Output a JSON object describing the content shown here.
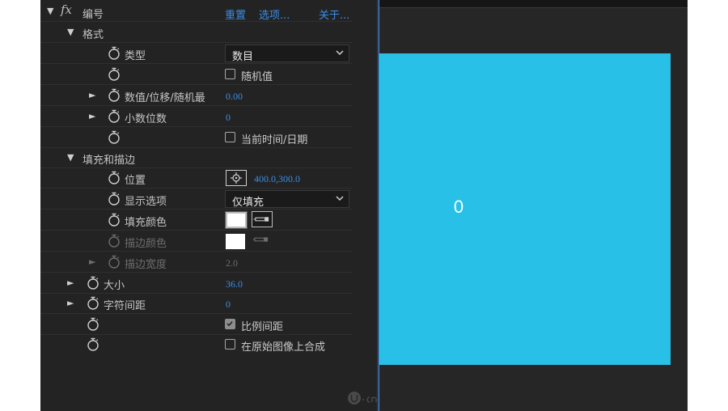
{
  "effect": {
    "name": "编号",
    "reset": "重置",
    "options": "选项...",
    "about": "关于..."
  },
  "format": {
    "group_label": "格式",
    "type_label": "类型",
    "type_value": "数目",
    "random_label": "随机值",
    "random_checked": false,
    "offset_label": "数值/位移/随机最",
    "offset_value": "0.00",
    "decimals_label": "小数位数",
    "decimals_value": "0",
    "current_time_label": "当前时间/日期",
    "current_time_checked": false
  },
  "fill_stroke": {
    "group_label": "填充和描边",
    "position_label": "位置",
    "position_value": "400.0,300.0",
    "display_label": "显示选项",
    "display_value": "仅填充",
    "fill_color_label": "填充颜色",
    "fill_color": "#ffffff",
    "stroke_color_label": "描边颜色",
    "stroke_color": "#ffffff",
    "stroke_width_label": "描边宽度",
    "stroke_width_value": "2.0"
  },
  "size": {
    "label": "大小",
    "value": "36.0"
  },
  "tracking": {
    "label": "字符间距",
    "value": "0"
  },
  "proportional": {
    "label": "比例间距",
    "checked": true
  },
  "composite": {
    "label": "在原始图像上合成",
    "checked": false
  },
  "viewer": {
    "canvas_color": "#29c0e8",
    "displayed_number": "0"
  },
  "colors": {
    "accent": "#3b8ee5",
    "panel_bg": "#232323"
  }
}
